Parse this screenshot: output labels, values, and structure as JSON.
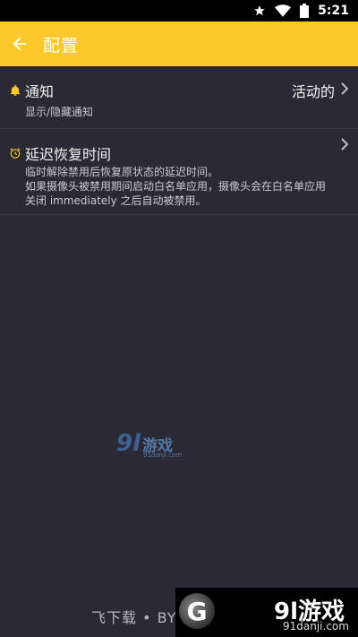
{
  "statusbar": {
    "time": "5:21",
    "icons": [
      "star-icon",
      "wifi-icon",
      "battery-icon"
    ]
  },
  "appbar": {
    "title": "配置",
    "back_icon": "arrow-left-icon",
    "color": "#fcc92a"
  },
  "settings": [
    {
      "icon": "bell-icon",
      "title": "通知",
      "subtitle": "显示/隐藏通知",
      "value": "活动的"
    },
    {
      "icon": "alarm-clock-icon",
      "title": "延迟恢复时间",
      "subtitle": "临时解除禁用后恢复原状态的延迟时间。\n如果摄像头被禁用期间启动白名单应用，摄像头会在白名单应用关闭 immediately 之后自动被禁用。"
    }
  ],
  "watermark": {
    "logo": "9l",
    "text": "游戏",
    "url": "91danji.com"
  },
  "bottom_brand": "飞下载 • BYIZXY.COM",
  "corner_logo": {
    "badge": "G",
    "brand": "9l游戏",
    "url": "91danji.com"
  }
}
